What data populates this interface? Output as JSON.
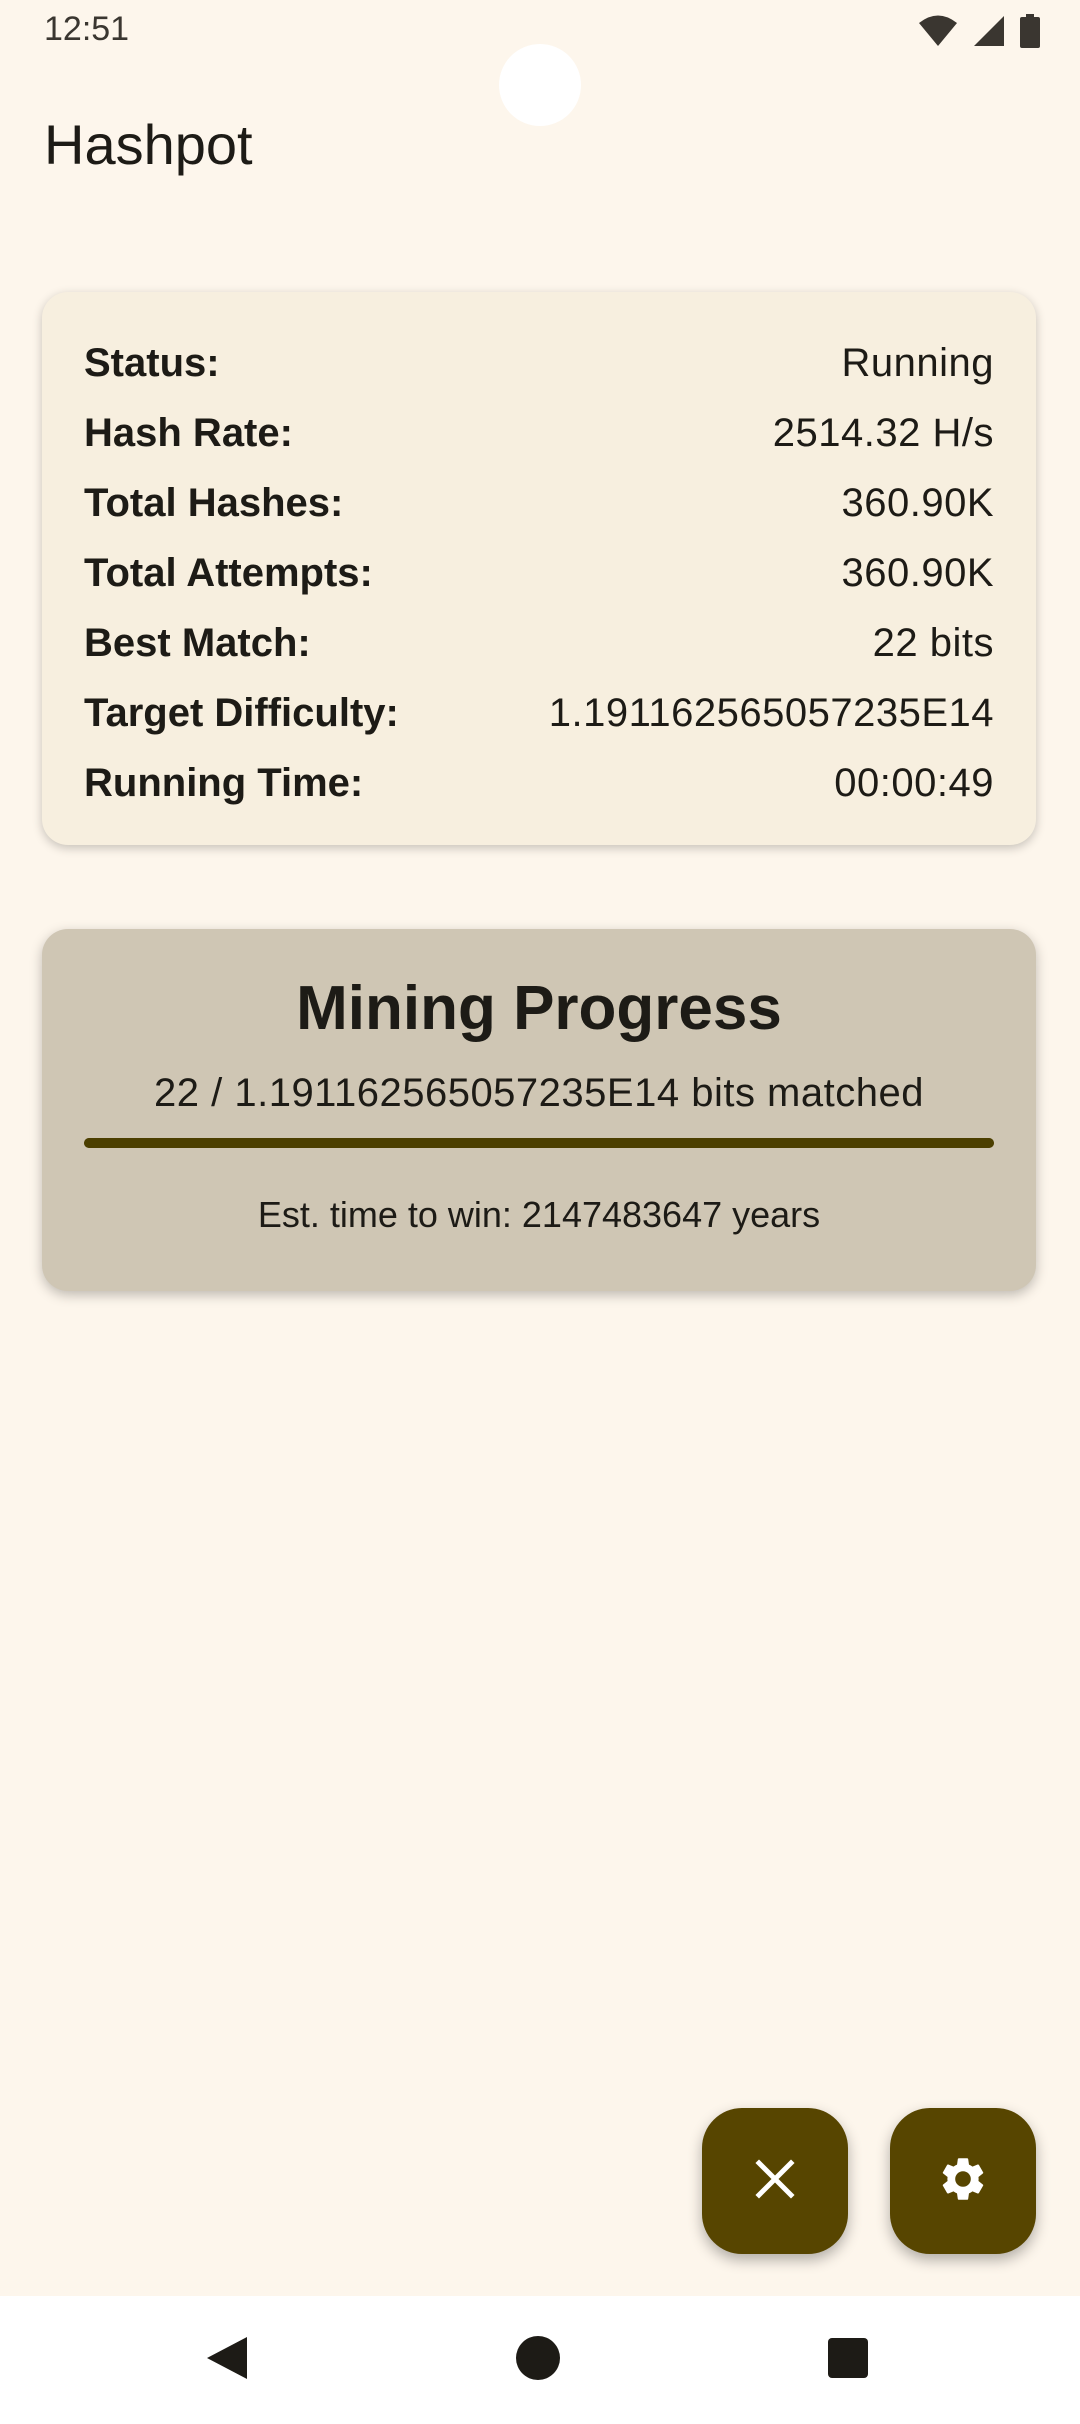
{
  "status_bar": {
    "time": "12:51",
    "icons": [
      "wifi-icon",
      "signal-icon",
      "battery-icon"
    ]
  },
  "app": {
    "title": "Hashpot"
  },
  "stats": [
    {
      "label": "Status:",
      "value": "Running"
    },
    {
      "label": "Hash Rate:",
      "value": "2514.32 H/s"
    },
    {
      "label": "Total Hashes:",
      "value": "360.90K"
    },
    {
      "label": "Total Attempts:",
      "value": "360.90K"
    },
    {
      "label": "Best Match:",
      "value": "22 bits"
    },
    {
      "label": "Target Difficulty:",
      "value": "1.191162565057235E14"
    },
    {
      "label": "Running Time:",
      "value": "00:00:49"
    }
  ],
  "progress": {
    "title": "Mining Progress",
    "subtitle": "22 / 1.191162565057235E14 bits matched",
    "fraction": 1.0,
    "eta": "Est. time to win: 2147483647 years"
  },
  "fabs": {
    "stop_icon": "close-icon",
    "settings_icon": "gear-icon"
  },
  "colors": {
    "background": "#fdf6ec",
    "stats_card": "#f7efdf",
    "progress_card": "#cfc6b4",
    "accent": "#574500"
  },
  "nav": {
    "icons": [
      "back-icon",
      "home-icon",
      "recents-icon"
    ]
  }
}
